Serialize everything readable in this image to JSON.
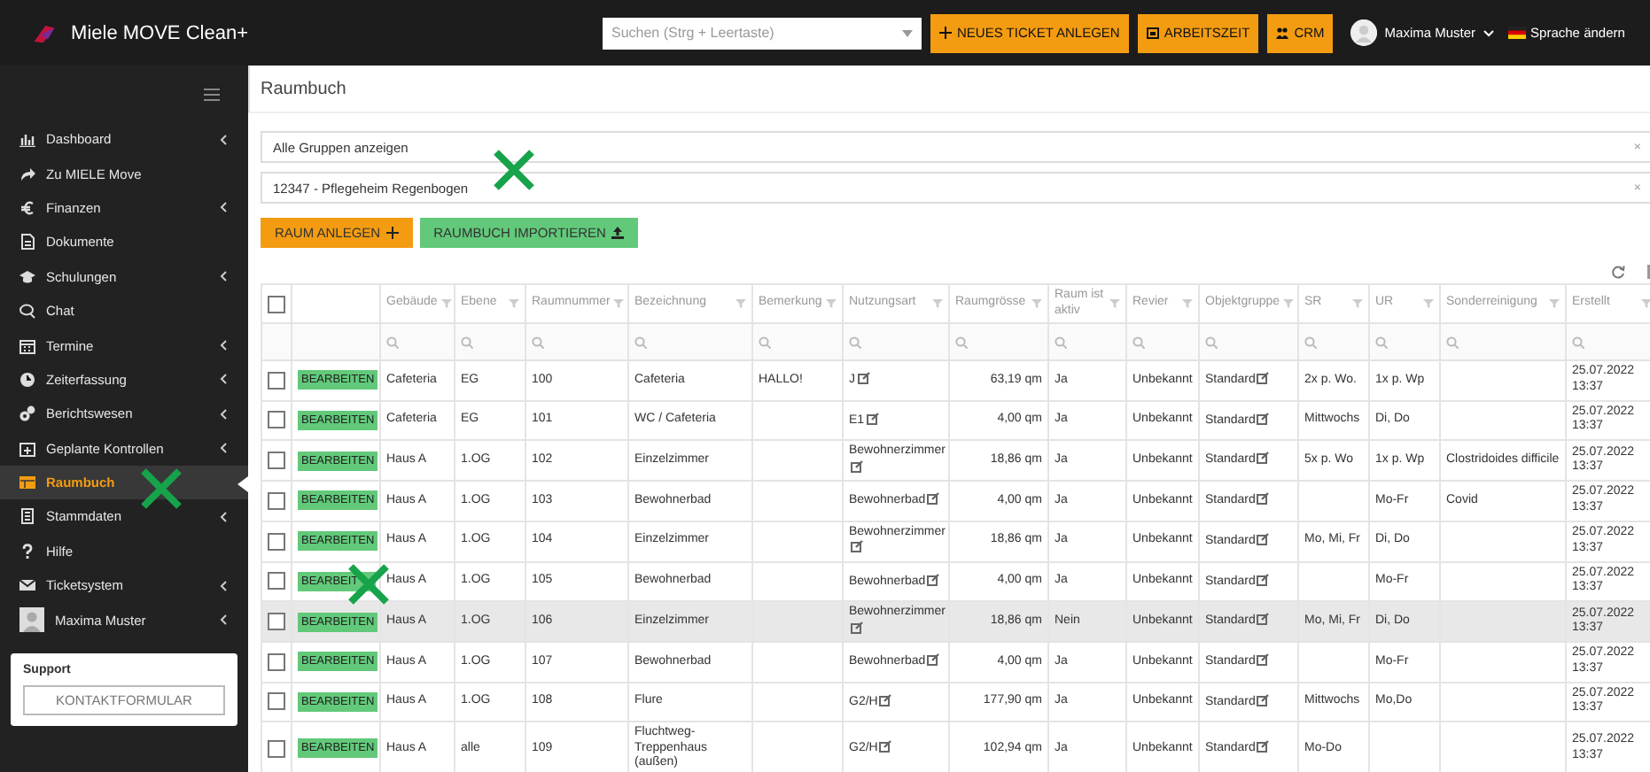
{
  "app": {
    "title": "Miele MOVE Clean+"
  },
  "topbar": {
    "search": {
      "placeholder": "Suchen (Strg + Leertaste)"
    },
    "buttons": [
      {
        "label": "NEUES TICKET ANLEGEN"
      },
      {
        "label": "ARBEITSZEIT"
      },
      {
        "label": "CRM"
      }
    ],
    "user": "Maxima Muster",
    "language": "Sprache ändern"
  },
  "sidebar": {
    "items": [
      {
        "label": "Dashboard",
        "expandable": true,
        "selected": false
      },
      {
        "label": "Zu MIELE Move",
        "expandable": false,
        "selected": false
      },
      {
        "label": "Finanzen",
        "expandable": true,
        "selected": false
      },
      {
        "label": "Dokumente",
        "expandable": false,
        "selected": false
      },
      {
        "label": "Schulungen",
        "expandable": true,
        "selected": false
      },
      {
        "label": "Chat",
        "expandable": false,
        "selected": false
      },
      {
        "label": "Termine",
        "expandable": true,
        "selected": false
      },
      {
        "label": "Zeiterfassung",
        "expandable": true,
        "selected": false
      },
      {
        "label": "Berichtswesen",
        "expandable": true,
        "selected": false
      },
      {
        "label": "Geplante Kontrollen",
        "expandable": true,
        "selected": false
      },
      {
        "label": "Raumbuch",
        "expandable": false,
        "selected": true
      },
      {
        "label": "Stammdaten",
        "expandable": true,
        "selected": false
      },
      {
        "label": "Hilfe",
        "expandable": false,
        "selected": false
      },
      {
        "label": "Ticketsystem",
        "expandable": true,
        "selected": false
      },
      {
        "label": "Maxima Muster",
        "expandable": true,
        "selected": false
      }
    ],
    "support": {
      "title": "Support",
      "button": "KONTAKTFORMULAR"
    }
  },
  "page": {
    "title": "Raumbuch",
    "filters": [
      {
        "value": "Alle Gruppen anzeigen",
        "clear": "×"
      },
      {
        "value": "12347 - Pflegeheim Regenbogen",
        "clear": "×"
      }
    ],
    "buttons": [
      {
        "label": "RAUM ANLEGEN",
        "kind": "primary"
      },
      {
        "label": "RAUMBUCH IMPORTIEREN",
        "kind": "success"
      }
    ]
  },
  "table": {
    "select_all": {
      "checked": false
    },
    "columns": [
      {
        "label": "Gebäude",
        "editable": false
      },
      {
        "label": "Ebene",
        "editable": false
      },
      {
        "label": "Raumnummer",
        "editable": false
      },
      {
        "label": "Bezeichnung",
        "editable": false
      },
      {
        "label": "Bemerkung",
        "editable": false
      },
      {
        "label": "Nutzungsart",
        "editable": true
      },
      {
        "label": "Raumgrösse",
        "editable": false
      },
      {
        "label": "Raum ist aktiv",
        "editable": false
      },
      {
        "label": "Revier",
        "editable": false
      },
      {
        "label": "Objektgruppe",
        "editable": true
      },
      {
        "label": "SR",
        "editable": false
      },
      {
        "label": "UR",
        "editable": false
      },
      {
        "label": "Sonderreinigung",
        "editable": false
      },
      {
        "label": "Erstellt",
        "editable": false
      }
    ],
    "rows": [
      {
        "checked": false,
        "selected": false,
        "action": "BEARBEITEN",
        "cells": [
          "Cafeteria",
          "EG",
          "100",
          "Cafeteria",
          "HALLO!",
          "J",
          "63,19 qm",
          "Ja",
          "Unbekannt",
          "Standard",
          "2x p. Wo.",
          "1x p. Wp",
          "",
          "25.07.2022 13:37"
        ]
      },
      {
        "checked": false,
        "selected": false,
        "action": "BEARBEITEN",
        "cells": [
          "Cafeteria",
          "EG",
          "101",
          "WC / Cafeteria",
          "",
          "E1",
          "4,00 qm",
          "Ja",
          "Unbekannt",
          "Standard",
          "Mittwochs",
          "Di, Do",
          "",
          "25.07.2022 13:37"
        ]
      },
      {
        "checked": false,
        "selected": false,
        "action": "BEARBEITEN",
        "cells": [
          "Haus A",
          "1.OG",
          "102",
          "Einzelzimmer",
          "",
          "Bewohnerzimmer",
          "18,86 qm",
          "Ja",
          "Unbekannt",
          "Standard",
          "5x p. Wo",
          "1x p. Wp",
          "Clostridoides difficile",
          "25.07.2022 13:37"
        ]
      },
      {
        "checked": false,
        "selected": false,
        "action": "BEARBEITEN",
        "cells": [
          "Haus A",
          "1.OG",
          "103",
          "Bewohnerbad",
          "",
          "Bewohnerbad",
          "4,00 qm",
          "Ja",
          "Unbekannt",
          "Standard",
          "",
          "Mo-Fr",
          "Covid",
          "25.07.2022 13:37"
        ]
      },
      {
        "checked": false,
        "selected": false,
        "action": "BEARBEITEN",
        "cells": [
          "Haus A",
          "1.OG",
          "104",
          "Einzelzimmer",
          "",
          "Bewohnerzimmer",
          "18,86 qm",
          "Ja",
          "Unbekannt",
          "Standard",
          "Mo, Mi, Fr",
          "Di, Do",
          "",
          "25.07.2022 13:37"
        ]
      },
      {
        "checked": false,
        "selected": false,
        "action": "BEARBEIT",
        "cells": [
          "Haus A",
          "1.OG",
          "105",
          "Bewohnerbad",
          "",
          "Bewohnerbad",
          "4,00 qm",
          "Ja",
          "Unbekannt",
          "Standard",
          "",
          "Mo-Fr",
          "",
          "25.07.2022 13:37"
        ]
      },
      {
        "checked": false,
        "selected": true,
        "action": "BEARBEITEN",
        "cells": [
          "Haus A",
          "1.OG",
          "106",
          "Einzelzimmer",
          "",
          "Bewohnerzimmer",
          "18,86 qm",
          "Nein",
          "Unbekannt",
          "Standard",
          "Mo, Mi, Fr",
          "Di, Do",
          "",
          "25.07.2022 13:37"
        ]
      },
      {
        "checked": false,
        "selected": false,
        "action": "BEARBEITEN",
        "cells": [
          "Haus A",
          "1.OG",
          "107",
          "Bewohnerbad",
          "",
          "Bewohnerbad",
          "4,00 qm",
          "Ja",
          "Unbekannt",
          "Standard",
          "",
          "Mo-Fr",
          "",
          "25.07.2022 13:37"
        ]
      },
      {
        "checked": false,
        "selected": false,
        "action": "BEARBEITEN",
        "cells": [
          "Haus A",
          "1.OG",
          "108",
          "Flure",
          "",
          "G2/H",
          "177,90 qm",
          "Ja",
          "Unbekannt",
          "Standard",
          "Mittwochs",
          "Mo,Do",
          "",
          "25.07.2022 13:37"
        ]
      },
      {
        "checked": false,
        "selected": false,
        "action": "BEARBEITEN",
        "cells": [
          "Haus A",
          "alle",
          "109",
          "Fluchtweg-Treppenhaus (außen)",
          "",
          "G2/H",
          "102,94 qm",
          "Ja",
          "Unbekannt",
          "Standard",
          "Mo-Do",
          "",
          "",
          "25.07.2022 13:37"
        ]
      }
    ]
  }
}
